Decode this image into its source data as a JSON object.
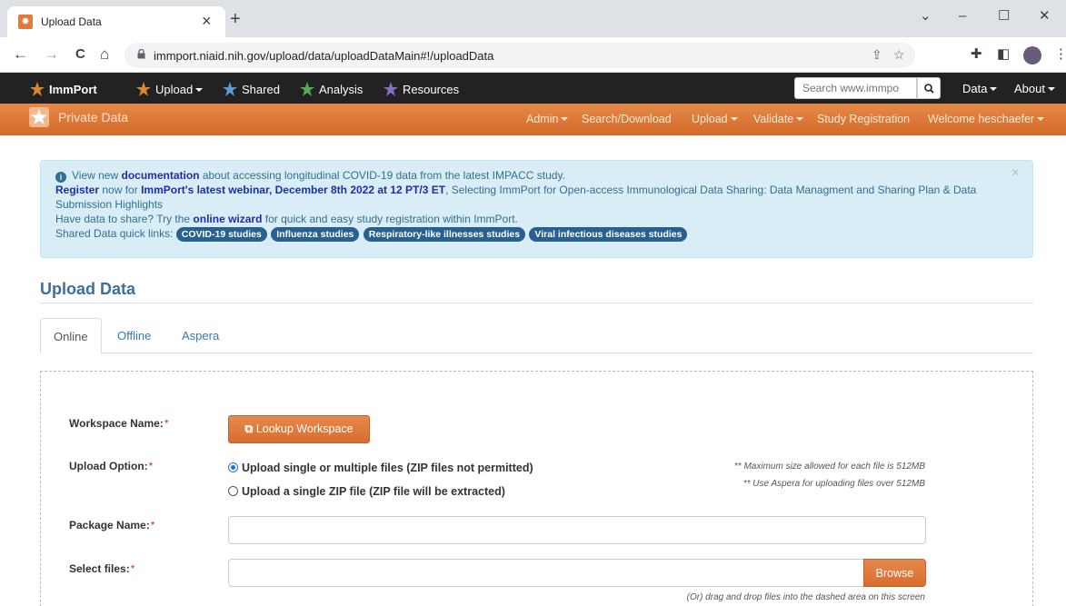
{
  "browser": {
    "tab_title": "Upload Data",
    "tab_close": "×",
    "new_tab": "+",
    "window_controls": [
      "⌄",
      "–",
      "☐",
      "✕"
    ],
    "url": "immport.niaid.nih.gov/upload/data/uploadDataMain#!/uploadData",
    "nav": {
      "back": "←",
      "forward": "→",
      "reload": "C",
      "home": "⌂"
    }
  },
  "topnav": {
    "brand": "ImmPort",
    "items": [
      {
        "label": "Upload",
        "dropdown": true
      },
      {
        "label": "Shared",
        "dropdown": false
      },
      {
        "label": "Analysis",
        "dropdown": false
      },
      {
        "label": "Resources",
        "dropdown": false
      }
    ],
    "search_placeholder": "Search www.immpo",
    "right_items": [
      "Data",
      "About"
    ]
  },
  "subnav": {
    "brand": "Private Data",
    "items": [
      "Admin",
      "Search/Download",
      "Upload",
      "Validate",
      "Study Registration",
      "Welcome heschaefer"
    ]
  },
  "alert": {
    "line1_a": "View new ",
    "line1_link": "documentation",
    "line1_b": " about accessing longitudinal COVID-19 data from the latest IMPACC study.",
    "line2_link": "Register",
    "line2_a": " now for ",
    "line2_strong": "ImmPort's latest webinar, December 8th 2022 at 12 PT/3 ET",
    "line2_b": ", Selecting ImmPort for Open-access Immunological Data Sharing: Data Managment and Sharing Plan & Data Submission Highlights",
    "line3_a": "Have data to share? Try the ",
    "line3_link": "online wizard",
    "line3_b": " for quick and easy study registration within ImmPort.",
    "line4_label": "Shared Data quick links:",
    "pills": [
      "COVID-19 studies",
      "Influenza studies",
      "Respiratory-like illnesses studies",
      "Viral infectious diseases studies"
    ],
    "close": "×"
  },
  "page": {
    "title": "Upload Data",
    "tabs": [
      "Online",
      "Offline",
      "Aspera"
    ],
    "form": {
      "workspace_label": "Workspace Name:",
      "lookup_button": "Lookup Workspace",
      "upload_option_label": "Upload Option:",
      "option1": "Upload single or multiple files (ZIP files not permitted)",
      "option2": "Upload a single ZIP file (ZIP file will be extracted)",
      "note1": "** Maximum size allowed for each file is 512MB",
      "note2": "** Use Aspera for uploading files over 512MB",
      "package_label": "Package Name:",
      "select_label": "Select files:",
      "browse_button": "Browse",
      "drag_hint": "(Or) drag and drop files into the dashed area on this screen",
      "required_mark": "*"
    }
  }
}
